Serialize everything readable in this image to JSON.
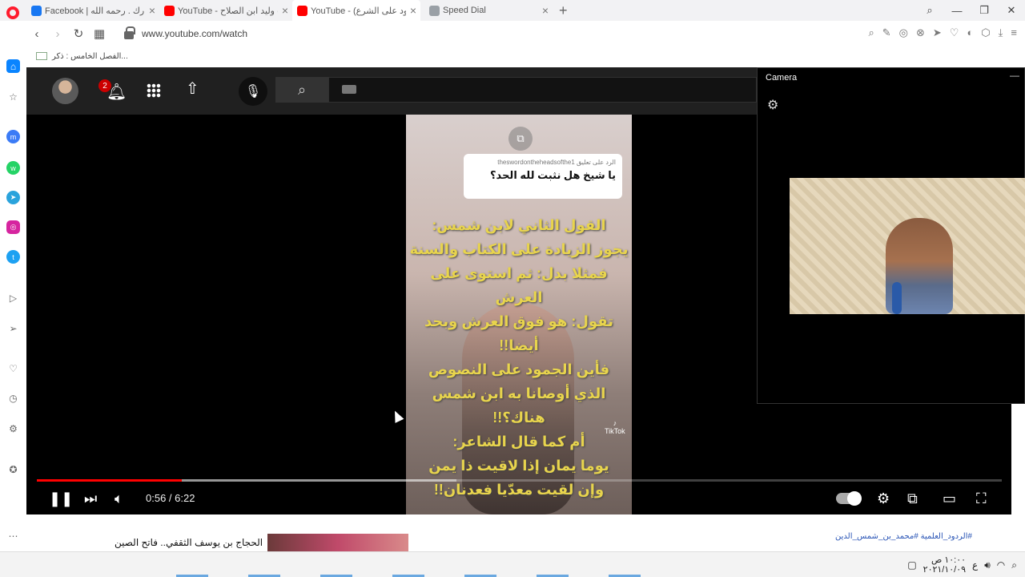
{
  "browser": {
    "tabs": [
      {
        "title": "Facebook | مبارك . رحمه الله ...",
        "fav_color": "#1877f2",
        "active": false
      },
      {
        "title": "YouTube - وليد ابن الصلاح @",
        "fav_color": "#ff0000",
        "active": false
      },
      {
        "title": "YouTube - (الجمود على الشرع)",
        "fav_color": "#ff0000",
        "active": true
      },
      {
        "title": "Speed Dial",
        "fav_color": "#9aa0a6",
        "active": false
      }
    ],
    "url": "www.youtube.com/watch",
    "bookmark": "الفصل الخامس : ذكر..."
  },
  "youtube": {
    "notification_count": "2",
    "video": {
      "comment_header": "الرد على تعليق theswordontheheadsofthe1",
      "comment_text": "يا شيخ هل نثبت لله الحد؟",
      "overlay_lines": [
        "القول الثاني لابن شمس:",
        "يجوز الزيادة على الكتاب والسنة",
        "فمثلا بدل: ثم استوى على العرش",
        "تقول: هو فوق العرش وبحد أيضا!!",
        "فأين الجمود على النصوص",
        "الذي أوصانا به ابن شمس هناك؟!!",
        "أم كما قال الشاعر:",
        "يوما يمان إذا لاقيت ذا يمن",
        "وإن لقيت معدّيا فعدنان!!"
      ],
      "watermark": "TikTok",
      "time_display": "0:56 / 6:22",
      "progress": 0.15,
      "autoplay": true
    },
    "recommended_title": "الحجاج بن يوسف الثقفي.. فاتح الصين",
    "hashtags": "#الردود_العلمية #محمد_بن_شمس_الدين"
  },
  "camera": {
    "title": "Camera"
  },
  "taskbar": {
    "time": "١٠:٠٠ ص",
    "date": "٢٠٢١/١٠/٠٩",
    "lang": "ع"
  }
}
